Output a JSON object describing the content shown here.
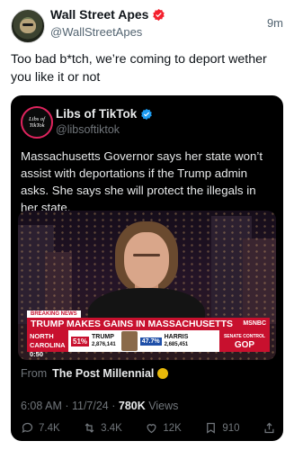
{
  "tweet": {
    "author_name": "Wall Street Apes",
    "author_handle": "@WallStreetApes",
    "time": "9m",
    "text": "Too bad b*tch, we’re coming to deport wether you like it or not"
  },
  "quoted": {
    "avatar_text": "Libs of TikTok",
    "author_name": "Libs of TikTok",
    "author_handle": "@libsoftiktok",
    "text": "Massachusetts Governor says her state won’t assist with deportations if the Trump admin asks. She says she will protect the illegals in her state.",
    "video": {
      "breaking_label": "BREAKING NEWS",
      "headline": "TRUMP MAKES GAINS IN MASSACHUSETTS",
      "network": "MSNBC",
      "ticker_left_top": "NORTH CAROLINA",
      "ticker_left_bottom": "0:50",
      "trump_pct": "51%",
      "trump_name": "TRUMP",
      "trump_votes": "2,876,141",
      "harris_pct": "47.7%",
      "harris_name": "HARRIS",
      "harris_votes": "2,685,451",
      "senate_label": "SENATE CONTROL",
      "gop": "GOP"
    },
    "from_label": "From",
    "from_source": "The Post Millennial",
    "timestamp": "6:08 AM · 11/7/24 ·",
    "views_count": "780K",
    "views_label": "Views",
    "actions": {
      "replies": "7.4K",
      "reposts": "3.4K",
      "likes": "12K",
      "bookmarks": "910"
    }
  },
  "colors": {
    "verified_blue": "#1d9bf0",
    "badge_red": "#f4212e",
    "breaking_red": "#c8102e",
    "gold_check": "#e8b90a"
  }
}
